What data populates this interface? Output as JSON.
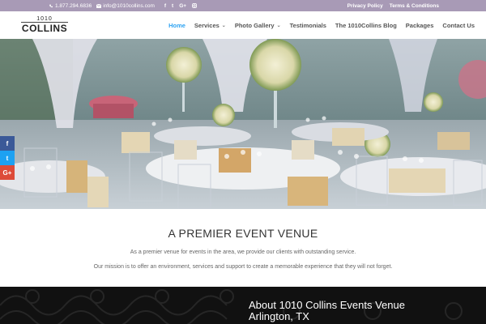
{
  "topbar": {
    "phone": "1.877.294.6836",
    "email": "info@1010collins.com",
    "social": [
      "f",
      "t",
      "G+",
      "ig"
    ],
    "links": [
      "Privacy Policy",
      "Terms & Conditions"
    ]
  },
  "logo": {
    "number": "1010",
    "name": "COLLINS"
  },
  "nav": {
    "items": [
      {
        "label": "Home",
        "active": true,
        "dropdown": false
      },
      {
        "label": "Services",
        "active": false,
        "dropdown": true
      },
      {
        "label": "Photo Gallery",
        "active": false,
        "dropdown": true
      },
      {
        "label": "Testimonials",
        "active": false,
        "dropdown": false
      },
      {
        "label": "The 1010Collins Blog",
        "active": false,
        "dropdown": false
      },
      {
        "label": "Packages",
        "active": false,
        "dropdown": false
      },
      {
        "label": "Contact Us",
        "active": false,
        "dropdown": false
      }
    ],
    "chevron": "⌄"
  },
  "share": {
    "facebook": "f",
    "twitter": "t",
    "google": "G+"
  },
  "content": {
    "title": "A PREMIER EVENT VENUE",
    "p1": "As a premier venue for events in the area, we provide our clients with outstanding service.",
    "p2": "Our mission is to offer an environment, services and support to create a memorable experience that they will not forget."
  },
  "about": {
    "line1": "About 1010 Collins Events Venue",
    "line2": "Arlington, TX"
  },
  "colors": {
    "topbar": "#a89ab6",
    "accent": "#2ea3f2",
    "dark": "#111111",
    "facebook": "#3b5998",
    "twitter": "#1da1f2",
    "google": "#dd4b39"
  }
}
